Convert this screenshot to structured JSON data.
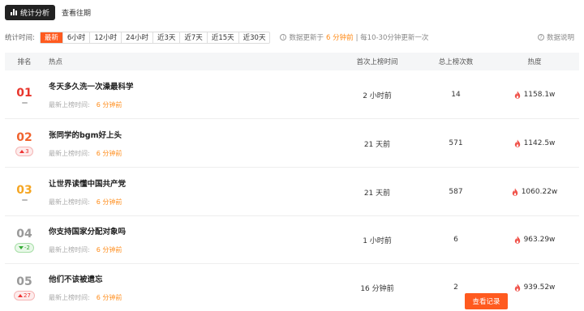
{
  "topbar": {
    "tab_active": "统计分析",
    "tab_history": "查看往期"
  },
  "filters": {
    "label": "统计时间:",
    "options": [
      "最新",
      "6小时",
      "12小时",
      "24小时",
      "近3天",
      "近7天",
      "近15天",
      "近30天"
    ],
    "active_index": 0,
    "update_prefix": "数据更新于",
    "update_time": "6 分钟前",
    "update_suffix": "| 每10-30分钟更新一次",
    "help_label": "数据说明"
  },
  "table": {
    "headers": {
      "rank": "排名",
      "topic": "热点",
      "first_time": "首次上榜时间",
      "total": "总上榜次数",
      "heat": "热度"
    },
    "meta_label": "最新上榜时间:",
    "rows": [
      {
        "rank": "01",
        "rank_color": "#e8362d",
        "change": "",
        "change_dir": "none",
        "title": "冬天多久洗一次澡最科学",
        "last_time": "6 分钟前",
        "first_time": "2 小时前",
        "total": "14",
        "heat": "1158.1w"
      },
      {
        "rank": "02",
        "rank_color": "#f0632e",
        "change": "3",
        "change_dir": "up",
        "title": "张同学的bgm好上头",
        "last_time": "6 分钟前",
        "first_time": "21 天前",
        "total": "571",
        "heat": "1142.5w"
      },
      {
        "rank": "03",
        "rank_color": "#f5a623",
        "change": "",
        "change_dir": "none",
        "title": "让世界读懂中国共产党",
        "last_time": "6 分钟前",
        "first_time": "21 天前",
        "total": "587",
        "heat": "1060.22w"
      },
      {
        "rank": "04",
        "rank_color": "#999999",
        "change": "-2",
        "change_dir": "down",
        "title": "你支持国家分配对象吗",
        "last_time": "6 分钟前",
        "first_time": "1 小时前",
        "total": "6",
        "heat": "963.29w"
      },
      {
        "rank": "05",
        "rank_color": "#999999",
        "change": "27",
        "change_dir": "up",
        "title": "他们不该被遗忘",
        "last_time": "6 分钟前",
        "first_time": "16 分钟前",
        "total": "2",
        "heat": "939.52w"
      }
    ]
  },
  "record_button": "查看记录",
  "colors": {
    "accent": "#ff5a1f",
    "highlight": "#ff8c1a"
  }
}
